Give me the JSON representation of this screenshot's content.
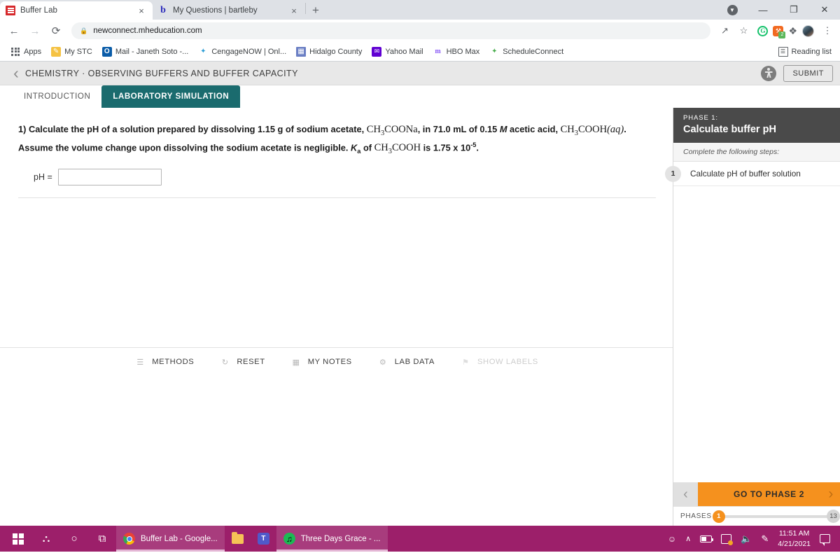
{
  "browser": {
    "tabs": [
      {
        "title": "Buffer Lab",
        "favicon": "mcgraw-hill-icon",
        "active": true,
        "close_label": "×"
      },
      {
        "title": "My Questions | bartleby",
        "favicon": "bartleby-icon",
        "active": false,
        "close_label": "×"
      }
    ],
    "new_tab_label": "+",
    "window_controls": {
      "download": "▼",
      "minimize": "—",
      "maximize": "❐",
      "close": "✕"
    },
    "nav": {
      "back": "←",
      "forward": "→",
      "reload": "⟳"
    },
    "omnibox": {
      "lock_icon": "🔒",
      "url": "newconnect.mheducation.com"
    },
    "omnibox_icons": {
      "share": "↗",
      "bookmark": "☆"
    },
    "extensions": [
      {
        "name": "grammarly-icon",
        "label": "G"
      },
      {
        "name": "extension-orange-icon",
        "label": "⚘",
        "badge": "2"
      },
      {
        "name": "puzzle-icon",
        "label": "❖"
      },
      {
        "name": "profile-avatar",
        "label": ""
      },
      {
        "name": "chrome-menu-icon",
        "label": "⋮"
      }
    ],
    "bookmarks": [
      {
        "label": "Apps",
        "icon": "apps-grid-icon"
      },
      {
        "label": "My STC",
        "icon": "pencil-icon"
      },
      {
        "label": "Mail - Janeth Soto -...",
        "icon": "outlook-icon"
      },
      {
        "label": "CengageNOW | Onl...",
        "icon": "cengage-icon"
      },
      {
        "label": "Hidalgo County",
        "icon": "building-icon"
      },
      {
        "label": "Yahoo Mail",
        "icon": "yahoo-mail-icon"
      },
      {
        "label": "HBO Max",
        "icon": "hbo-max-icon"
      },
      {
        "label": "ScheduleConnect",
        "icon": "schedule-connect-icon"
      }
    ],
    "reading_list": {
      "label": "Reading list",
      "icon": "reading-list-icon"
    }
  },
  "app": {
    "back_chevron": "‹",
    "course_title": "CHEMISTRY · OBSERVING BUFFERS AND BUFFER CAPACITY",
    "accessibility_icon": "accessibility-icon",
    "submit_label": "SUBMIT",
    "tabs": [
      {
        "label": "INTRODUCTION",
        "active": false
      },
      {
        "label": "LABORATORY SIMULATION",
        "active": true
      }
    ],
    "question": {
      "number": "1)",
      "part1": "Calculate the pH of a solution prepared by dissolving 1.15 g of sodium acetate, ",
      "formula1": "CH",
      "formula1_sub": "3",
      "formula1_rest": "COONa",
      "part2": ", in 71.0 mL of 0.15 ",
      "molarity": "M",
      "part3": " acetic acid, ",
      "formula2": "CH",
      "formula2_sub": "3",
      "formula2_rest": "COOH",
      "formula2_state": "(aq)",
      "part4": ". Assume the volume change upon dissolving the sodium acetate is negligible. ",
      "ka": "K",
      "ka_sub": "a",
      "part5": " of ",
      "formula3": "CH",
      "formula3_sub": "3",
      "formula3_rest": "COOH",
      "part6": " is 1.75 x 10",
      "exponent": "-5",
      "part7": "."
    },
    "answer": {
      "label": "pH =",
      "value": "",
      "placeholder": ""
    },
    "sim_toolbar": [
      {
        "label": "METHODS",
        "icon": "methods-stack-icon",
        "disabled": false
      },
      {
        "label": "RESET",
        "icon": "reset-circle-icon",
        "disabled": false
      },
      {
        "label": "MY NOTES",
        "icon": "notes-page-icon",
        "disabled": false
      },
      {
        "label": "LAB DATA",
        "icon": "flask-icon",
        "disabled": false
      },
      {
        "label": "SHOW LABELS",
        "icon": "tag-icon",
        "disabled": true
      }
    ]
  },
  "sidebar": {
    "phase_kicker": "PHASE 1:",
    "phase_name": "Calculate buffer pH",
    "steps_subtitle": "Complete the following steps:",
    "steps": [
      {
        "number": "1",
        "label": "Calculate pH of buffer solution"
      }
    ],
    "nav": {
      "prev_chevron": "‹",
      "label": "GO TO PHASE 2",
      "next_chevron": "›"
    },
    "phases": {
      "label": "PHASES",
      "current": "1",
      "total": "13"
    }
  },
  "taskbar": {
    "start_icon": "windows-start-icon",
    "search_icon": "⚲",
    "cortana_icon": "○",
    "taskview_icon": "⧉",
    "apps": [
      {
        "label": "Buffer Lab - Google...",
        "icon": "chrome-icon",
        "running": true
      },
      {
        "label": "",
        "icon": "file-explorer-icon",
        "running": false
      },
      {
        "label": "",
        "icon": "teams-icon",
        "running": false
      },
      {
        "label": "Three Days Grace - ...",
        "icon": "spotify-icon",
        "running": true
      }
    ],
    "tray": {
      "people_icon": "⛬",
      "chevron_up": "∧",
      "battery_icon": "battery-icon",
      "picture_icon": "picture-tray-icon",
      "volume_icon": "ὐa",
      "pen_icon": "✎",
      "time": "11:51 AM",
      "date": "4/21/2021",
      "notification_icon": "notification-icon"
    }
  }
}
